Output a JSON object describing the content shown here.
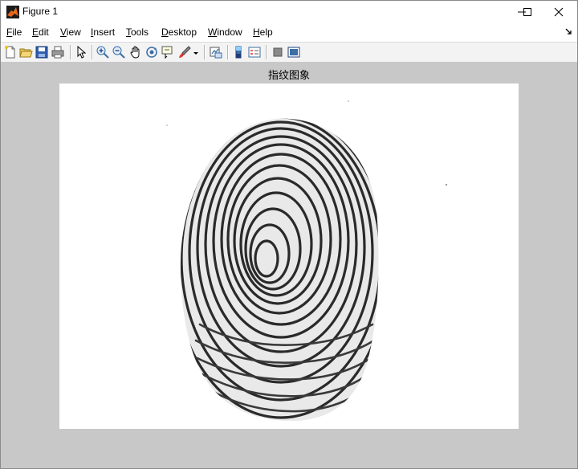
{
  "window": {
    "title": "Figure 1"
  },
  "menu": {
    "items": [
      {
        "accel": "F",
        "rest": "ile"
      },
      {
        "accel": "E",
        "rest": "dit"
      },
      {
        "accel": "V",
        "rest": "iew"
      },
      {
        "accel": "I",
        "rest": "nsert"
      },
      {
        "accel": "T",
        "rest": "ools"
      },
      {
        "accel": "D",
        "rest": "esktop"
      },
      {
        "accel": "W",
        "rest": "indow"
      },
      {
        "accel": "H",
        "rest": "elp"
      }
    ]
  },
  "toolbar": {
    "icons": [
      "new-figure-icon",
      "open-file-icon",
      "save-icon",
      "print-icon",
      "edit-plot-icon",
      "zoom-in-icon",
      "zoom-out-icon",
      "pan-icon",
      "rotate-3d-icon",
      "data-cursor-icon",
      "brush-icon",
      "link-plot-icon",
      "insert-colorbar-icon",
      "insert-legend-icon",
      "hide-plot-tools-icon",
      "show-plot-tools-icon"
    ]
  },
  "figure": {
    "axes_title": "指纹图象",
    "background": "#c8c8c8",
    "image_content": "fingerprint"
  }
}
